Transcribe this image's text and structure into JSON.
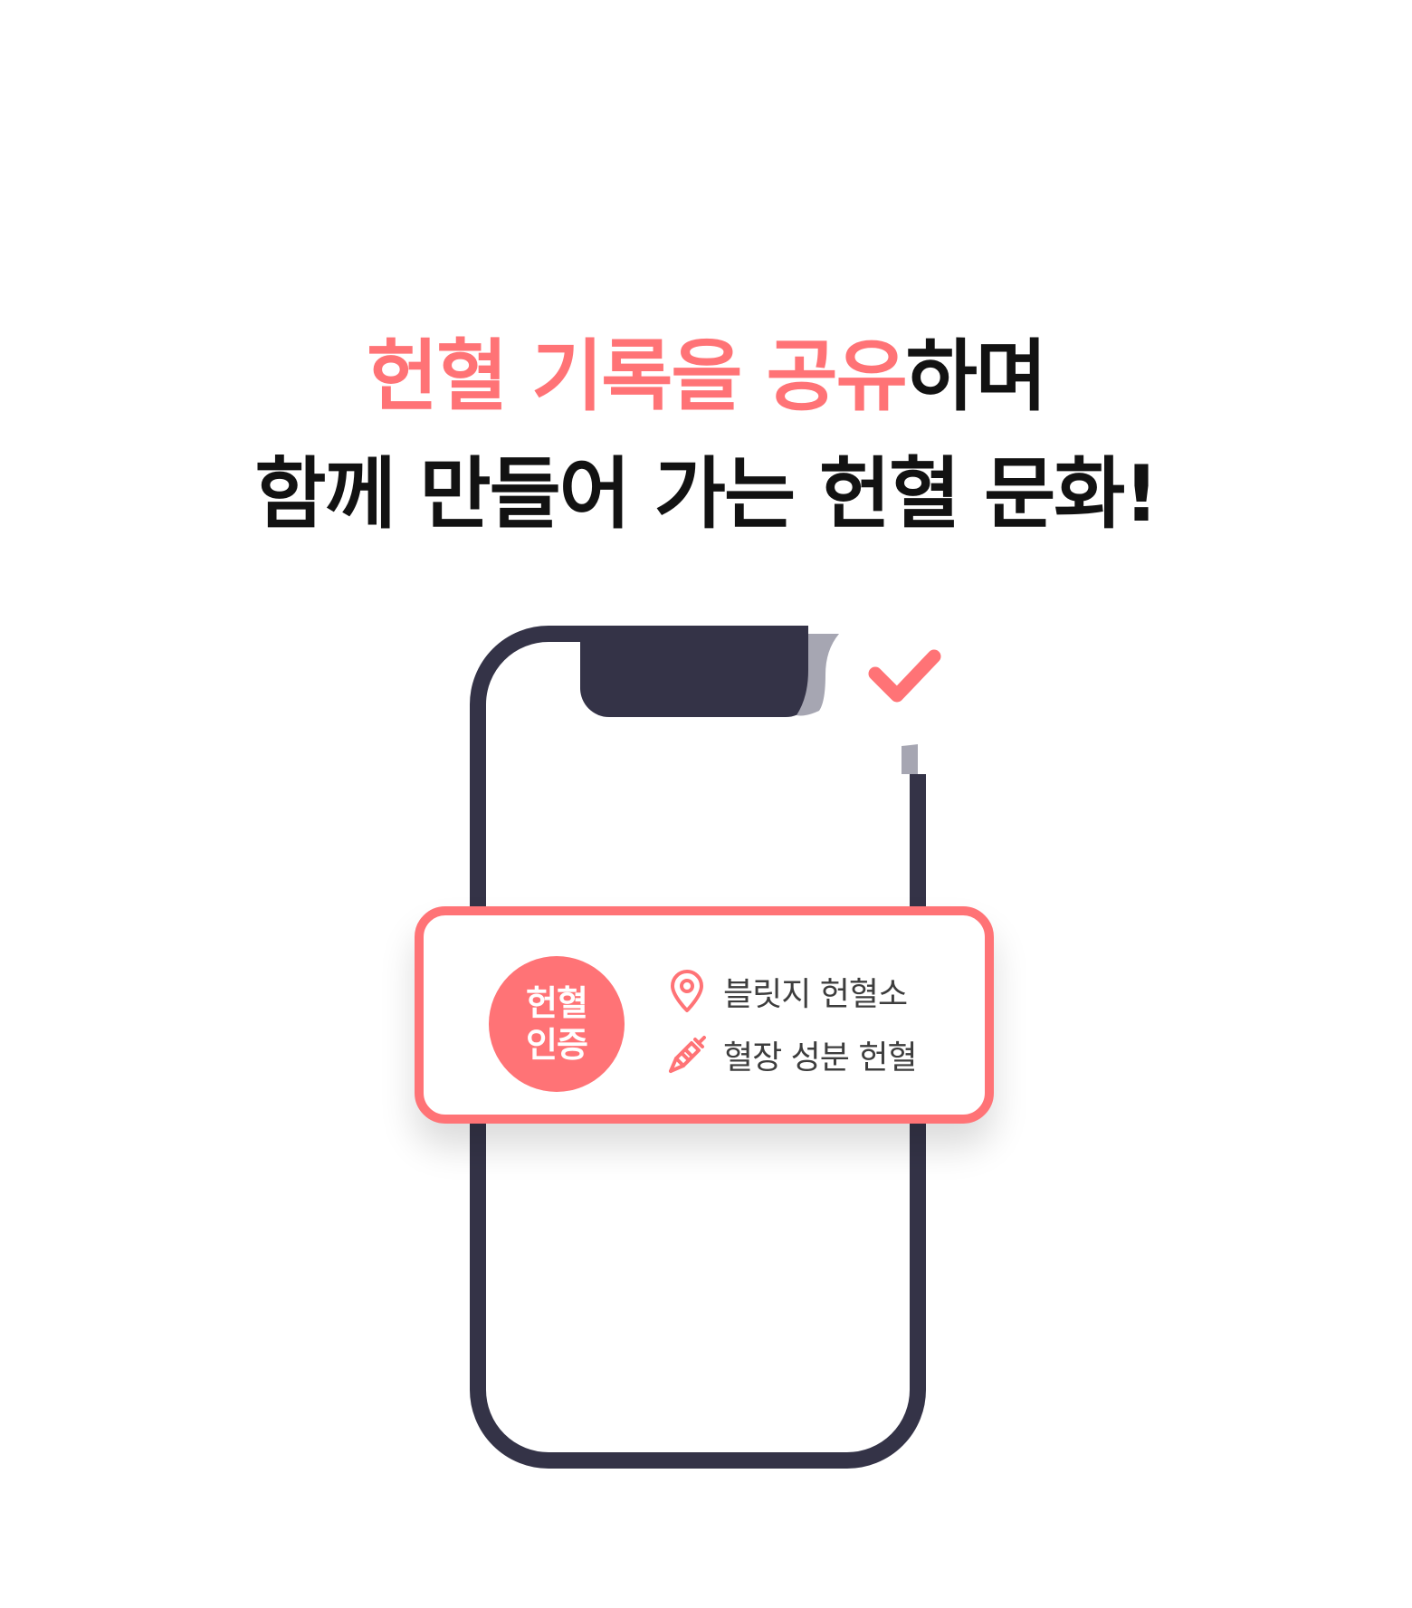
{
  "headline": {
    "line1_accent": "헌혈 기록을 공유",
    "line1_rest": "하며",
    "line2": "함께 만들어 가는 헌혈 문화!"
  },
  "card": {
    "badge_line1": "헌혈",
    "badge_line2": "인증",
    "location": "블릿지 헌혈소",
    "donation_type": "혈장 성분 헌혈"
  },
  "icons": {
    "location": "map-pin-icon",
    "donation_type": "syringe-icon",
    "check": "checkmark-icon"
  },
  "colors": {
    "accent": "#ff7376",
    "phone_frame": "#343347",
    "phone_shadow": "#a6a6b2",
    "text_dark": "#121212",
    "text_body": "#3d3d3d"
  }
}
